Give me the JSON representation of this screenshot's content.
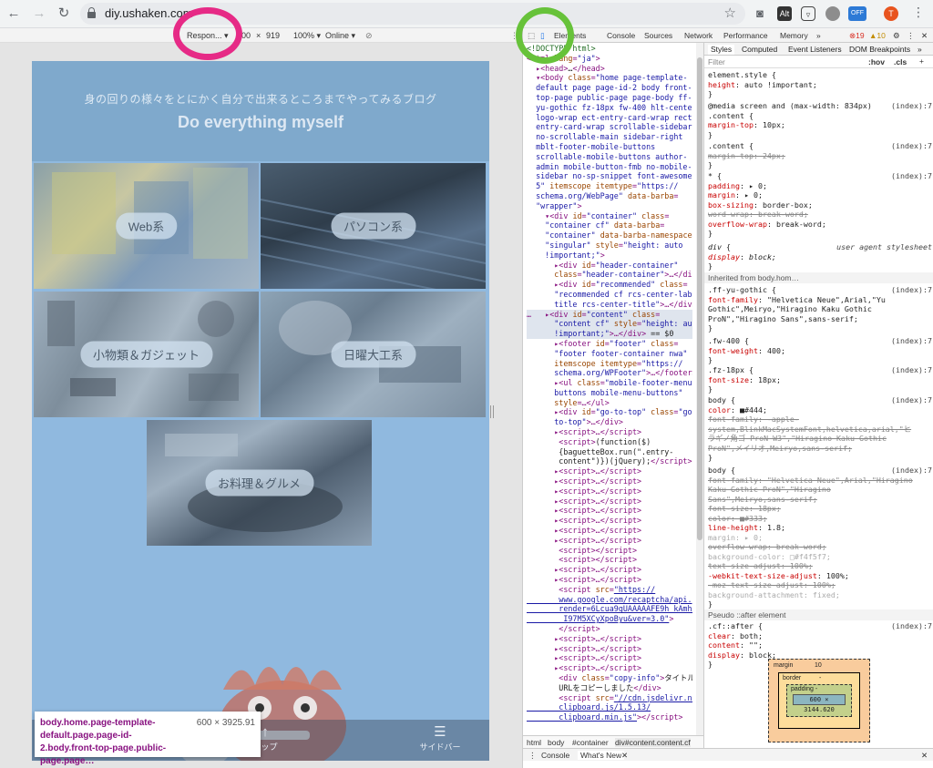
{
  "browser": {
    "url_host": "diy.ushaken.com",
    "ext_alt": "Alt",
    "ext_off": "OFF",
    "profile_initial": "T"
  },
  "device_toolbar": {
    "device": "Respon...",
    "width": "600",
    "x": "×",
    "height": "919",
    "zoom": "100%",
    "network": "Online"
  },
  "page": {
    "subtitle": "身の回りの様々をとにかく自分で出来るところまでやってみるブログ",
    "title": "Do everything myself",
    "categories": [
      "Web系",
      "パソコン系",
      "小物類＆ガジェット",
      "日曜大工系",
      "お料理＆グルメ"
    ],
    "bottom_nav": {
      "top": "トップ",
      "sidebar": "サイドバー"
    }
  },
  "tooltip": {
    "selector": "body.home.page-template-default.page.page-id-2.body.front-top-page.public-page.page…",
    "size": "600 × 3925.91"
  },
  "devtools": {
    "tabs": [
      "Elements",
      "Console",
      "Sources",
      "Network",
      "Performance",
      "Memory",
      "»"
    ],
    "errors": "19",
    "warnings": "10",
    "breadcrumbs": [
      "html",
      "body",
      "#container",
      "div#content.content.cf"
    ],
    "drawer_tabs": [
      "Console",
      "What's New"
    ],
    "styles_tabs": [
      "Styles",
      "Computed",
      "Event Listeners",
      "DOM Breakpoints",
      "»"
    ],
    "filter_placeholder": "Filter",
    "filter_hov": ":hov",
    "filter_cls": ".cls",
    "inherited_label": "Inherited from body.hom…",
    "pseudo_label": "Pseudo ::after element",
    "box_model": {
      "margin": "margin",
      "margin_value": "10",
      "border": "border",
      "border_value": "-",
      "padding": "padding -",
      "content": "600 × 3144.620",
      "dash": "-"
    }
  }
}
